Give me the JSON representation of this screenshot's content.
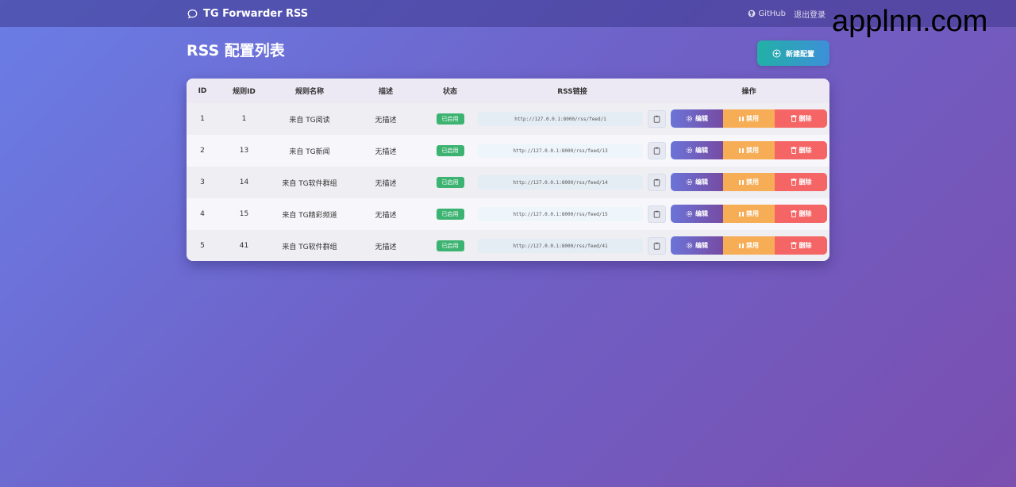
{
  "navbar": {
    "brand": "TG Forwarder RSS",
    "github_label": "GitHub",
    "logout_label": "退出登录"
  },
  "watermark": "applnn.com",
  "page": {
    "title": "RSS 配置列表",
    "new_button_label": "新建配置"
  },
  "table": {
    "columns": [
      "ID",
      "规则ID",
      "规则名称",
      "描述",
      "状态",
      "RSS链接",
      "操作"
    ],
    "rows": [
      {
        "id": "1",
        "rule_id": "1",
        "name": "来自 TG阅读",
        "desc": "无描述",
        "status": "已启用",
        "link": "http://127.0.0.1:8000/rss/feed/1"
      },
      {
        "id": "2",
        "rule_id": "13",
        "name": "来自 TG新闻",
        "desc": "无描述",
        "status": "已启用",
        "link": "http://127.0.0.1:8000/rss/feed/13"
      },
      {
        "id": "3",
        "rule_id": "14",
        "name": "来自 TG软件群组",
        "desc": "无描述",
        "status": "已启用",
        "link": "http://127.0.0.1:8000/rss/feed/14"
      },
      {
        "id": "4",
        "rule_id": "15",
        "name": "来自 TG精彩频道",
        "desc": "无描述",
        "status": "已启用",
        "link": "http://127.0.0.1:8000/rss/feed/15"
      },
      {
        "id": "5",
        "rule_id": "41",
        "name": "来自 TG软件群组",
        "desc": "无描述",
        "status": "已启用",
        "link": "http://127.0.0.1:8000/rss/feed/41"
      }
    ],
    "actions": {
      "edit": "编辑",
      "disable": "禁用",
      "delete": "删除"
    }
  },
  "colors": {
    "accent": "#667eea",
    "enabled_badge": "#3cb371",
    "disable_button": "#f6ad55",
    "delete_button": "#f56565"
  }
}
